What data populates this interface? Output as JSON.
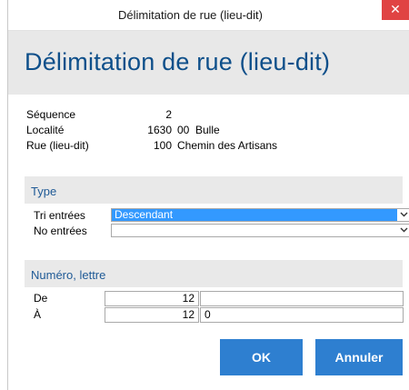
{
  "window": {
    "title": "Délimitation de rue (lieu-dit)",
    "close_glyph": "✕",
    "close_color": "#e04343"
  },
  "header": {
    "title": "Délimitation de rue (lieu-dit)",
    "title_color": "#0e4f8a"
  },
  "info": {
    "sequence_label": "Séquence",
    "sequence_value": "2",
    "localite_label": "Localité",
    "localite_npa": "1630",
    "localite_code": "00",
    "localite_name": "Bulle",
    "rue_label": "Rue (lieu-dit)",
    "rue_number": "100",
    "rue_name": "Chemin des Artisans"
  },
  "type_section": {
    "title": "Type",
    "tri_label": "Tri entrées",
    "tri_value": "Descendant",
    "no_label": "No entrées",
    "no_value": "",
    "arrow_icon": "chevron-down-icon"
  },
  "numero_section": {
    "title": "Numéro, lettre",
    "de_label": "De",
    "de_number": "12",
    "de_letter": "",
    "a_label": "À",
    "a_number": "12",
    "a_letter": "0"
  },
  "buttons": {
    "ok_label": "OK",
    "cancel_label": "Annuler",
    "accent_color": "#2e7fd0"
  }
}
